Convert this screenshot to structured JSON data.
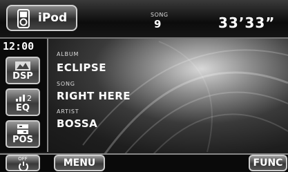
{
  "header": {
    "source_label": "iPod",
    "song_caption": "SONG",
    "song_number": "9",
    "elapsed_time": "33’33”"
  },
  "sidebar": {
    "clock": "12:00",
    "buttons": [
      {
        "label": "DSP",
        "icon": "dsp-icon"
      },
      {
        "label": "EQ",
        "icon": "eq-icon"
      },
      {
        "label": "POS",
        "icon": "pos-icon"
      }
    ]
  },
  "info": {
    "album_caption": "ALBUM",
    "album": "ECLIPSE",
    "song_caption": "SONG",
    "song": "RIGHT HERE",
    "artist_caption": "ARTIST",
    "artist": "BOSSA"
  },
  "bottom": {
    "off_label": "OFF",
    "menu_label": "MENU",
    "func_label": "FUNC"
  },
  "colors": {
    "text": "#ffffff",
    "button_border": "#cccccc",
    "background_dark": "#101010"
  }
}
